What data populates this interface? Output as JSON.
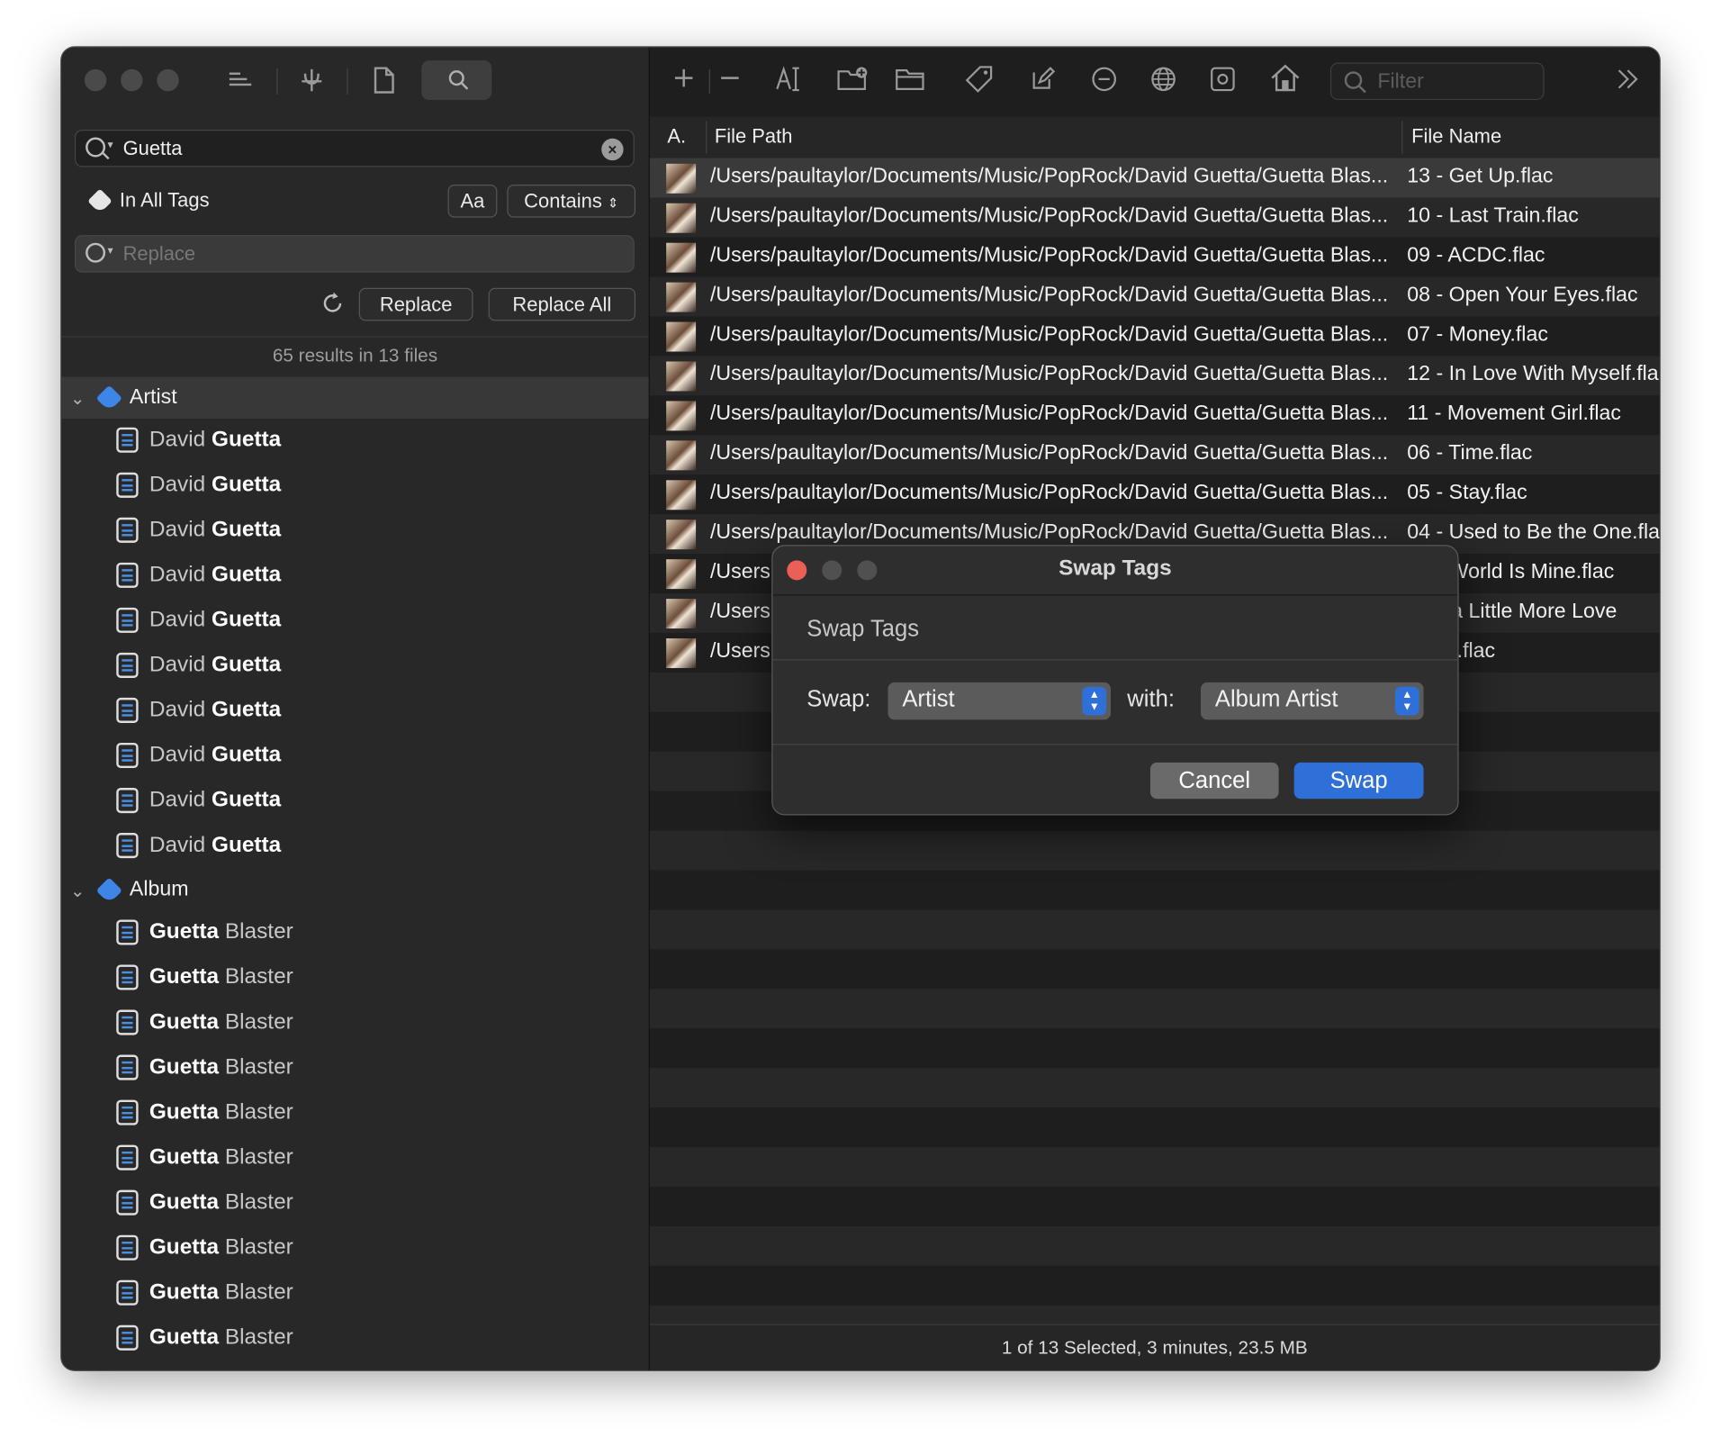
{
  "sidebar": {
    "search_value": "Guetta",
    "scope_label": "In All Tags",
    "case_button": "Aa",
    "match_mode": "Contains",
    "replace_placeholder": "Replace",
    "replace_button": "Replace",
    "replace_all_button": "Replace All",
    "results_summary": "65 results in 13 files",
    "groups": [
      {
        "label": "Artist",
        "rows": [
          {
            "pre": "David ",
            "hl": "Guetta",
            "post": ""
          },
          {
            "pre": "David ",
            "hl": "Guetta",
            "post": ""
          },
          {
            "pre": "David ",
            "hl": "Guetta",
            "post": ""
          },
          {
            "pre": "David ",
            "hl": "Guetta",
            "post": ""
          },
          {
            "pre": "David ",
            "hl": "Guetta",
            "post": ""
          },
          {
            "pre": "David ",
            "hl": "Guetta",
            "post": ""
          },
          {
            "pre": "David ",
            "hl": "Guetta",
            "post": ""
          },
          {
            "pre": "David ",
            "hl": "Guetta",
            "post": ""
          },
          {
            "pre": "David ",
            "hl": "Guetta",
            "post": ""
          },
          {
            "pre": "David ",
            "hl": "Guetta",
            "post": ""
          }
        ]
      },
      {
        "label": "Album",
        "rows": [
          {
            "pre": "",
            "hl": "Guetta",
            "post": " Blaster"
          },
          {
            "pre": "",
            "hl": "Guetta",
            "post": " Blaster"
          },
          {
            "pre": "",
            "hl": "Guetta",
            "post": " Blaster"
          },
          {
            "pre": "",
            "hl": "Guetta",
            "post": " Blaster"
          },
          {
            "pre": "",
            "hl": "Guetta",
            "post": " Blaster"
          },
          {
            "pre": "",
            "hl": "Guetta",
            "post": " Blaster"
          },
          {
            "pre": "",
            "hl": "Guetta",
            "post": " Blaster"
          },
          {
            "pre": "",
            "hl": "Guetta",
            "post": " Blaster"
          },
          {
            "pre": "",
            "hl": "Guetta",
            "post": " Blaster"
          },
          {
            "pre": "",
            "hl": "Guetta",
            "post": " Blaster"
          }
        ]
      }
    ]
  },
  "toolbar": {
    "filter_placeholder": "Filter"
  },
  "table": {
    "columns": [
      "A.",
      "File Path",
      "File Name"
    ],
    "rows": [
      {
        "path": "/Users/paultaylor/Documents/Music/PopRock/David Guetta/Guetta Blas...",
        "name": "13 - Get Up.flac"
      },
      {
        "path": "/Users/paultaylor/Documents/Music/PopRock/David Guetta/Guetta Blas...",
        "name": "10 - Last Train.flac"
      },
      {
        "path": "/Users/paultaylor/Documents/Music/PopRock/David Guetta/Guetta Blas...",
        "name": "09 - ACDC.flac"
      },
      {
        "path": "/Users/paultaylor/Documents/Music/PopRock/David Guetta/Guetta Blas...",
        "name": "08 - Open Your Eyes.flac"
      },
      {
        "path": "/Users/paultaylor/Documents/Music/PopRock/David Guetta/Guetta Blas...",
        "name": "07 - Money.flac"
      },
      {
        "path": "/Users/paultaylor/Documents/Music/PopRock/David Guetta/Guetta Blas...",
        "name": "12 - In Love With Myself.fla"
      },
      {
        "path": "/Users/paultaylor/Documents/Music/PopRock/David Guetta/Guetta Blas...",
        "name": "11 - Movement Girl.flac"
      },
      {
        "path": "/Users/paultaylor/Documents/Music/PopRock/David Guetta/Guetta Blas...",
        "name": "06 - Time.flac"
      },
      {
        "path": "/Users/paultaylor/Documents/Music/PopRock/David Guetta/Guetta Blas...",
        "name": "05 - Stay.flac"
      },
      {
        "path": "/Users/paultaylor/Documents/Music/PopRock/David Guetta/Guetta Blas...",
        "name": "04 - Used to Be the One.fla"
      },
      {
        "path": "/Users",
        "name": "The World Is Mine.flac"
      },
      {
        "path": "/Users",
        "name": "Just a Little More Love"
      },
      {
        "path": "/Users",
        "name": "ligher.flac"
      }
    ],
    "status": "1 of 13 Selected, 3 minutes, 23.5 MB"
  },
  "dialog": {
    "title": "Swap Tags",
    "section": "Swap Tags",
    "swap_label": "Swap:",
    "swap_value": "Artist",
    "with_label": "with:",
    "with_value": "Album Artist",
    "cancel": "Cancel",
    "confirm": "Swap"
  },
  "colors": {
    "accent": "#2f6fd8",
    "close_red": "#ec5f56",
    "tag_blue": "#3d86e8"
  },
  "icons": [
    "hamburger-icon",
    "tuning-fork-icon",
    "document-icon",
    "search-icon",
    "plus-icon",
    "minus-icon",
    "text-cursor-icon",
    "new-folder-icon",
    "folder-icon",
    "tag-icon",
    "edit-icon",
    "remove-icon",
    "globe-icon",
    "record-icon",
    "home-icon",
    "more-chevrons-icon"
  ]
}
